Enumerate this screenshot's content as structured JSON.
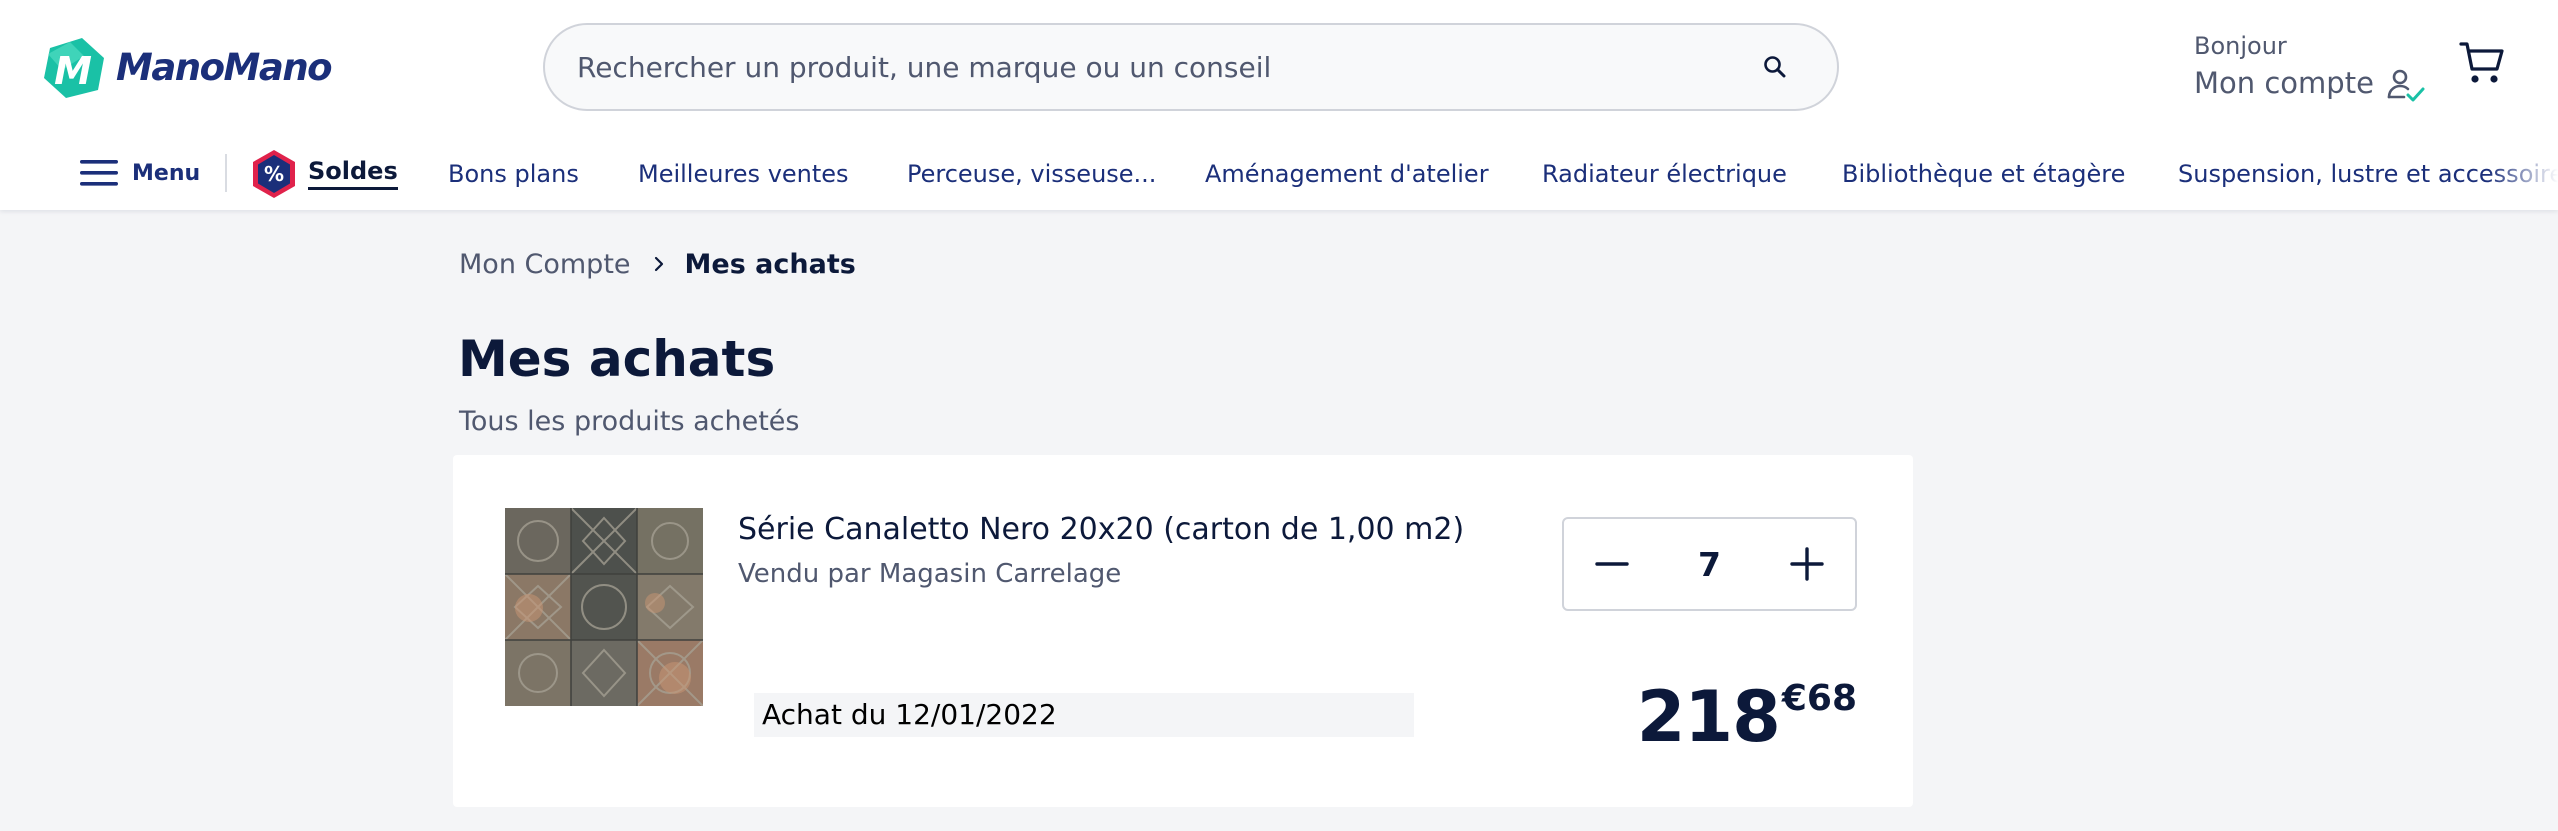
{
  "header": {
    "logo_text": "ManoMano",
    "search": {
      "placeholder": "Rechercher un produit, une marque ou un conseil"
    },
    "account": {
      "greeting": "Bonjour",
      "label": "Mon compte"
    }
  },
  "nav": {
    "menu_label": "Menu",
    "sale": {
      "badge": "%",
      "label": "Soldes"
    },
    "links": [
      "Bons plans",
      "Meilleures ventes",
      "Perceuse, visseuse...",
      "Aménagement d'atelier",
      "Radiateur électrique",
      "Bibliothèque et étagère",
      "Suspension, lustre et accessoire"
    ]
  },
  "breadcrumb": {
    "parent": "Mon Compte",
    "current": "Mes achats"
  },
  "page": {
    "title": "Mes achats",
    "subtitle": "Tous les produits achetés"
  },
  "purchase": {
    "title": "Série Canaletto Nero 20x20 (carton de 1,00 m2)",
    "seller": "Vendu par Magasin Carrelage",
    "quantity": "7",
    "date": "Achat du 12/01/2022",
    "price_int": "218",
    "price_dec": "€68"
  },
  "colors": {
    "brand_navy": "#1b2f7a",
    "text_dark": "#0c193a",
    "text_muted": "#50586f",
    "logo_teal": "#1ac1a6",
    "sale_red": "#e0224b",
    "page_bg": "#f4f5f7"
  },
  "icons": {
    "search": "search-icon",
    "account": "user-check-icon",
    "cart": "cart-icon",
    "menu": "hamburger-icon",
    "breadcrumb_sep": "chevron-right-icon",
    "minus": "minus-icon",
    "plus": "plus-icon"
  }
}
